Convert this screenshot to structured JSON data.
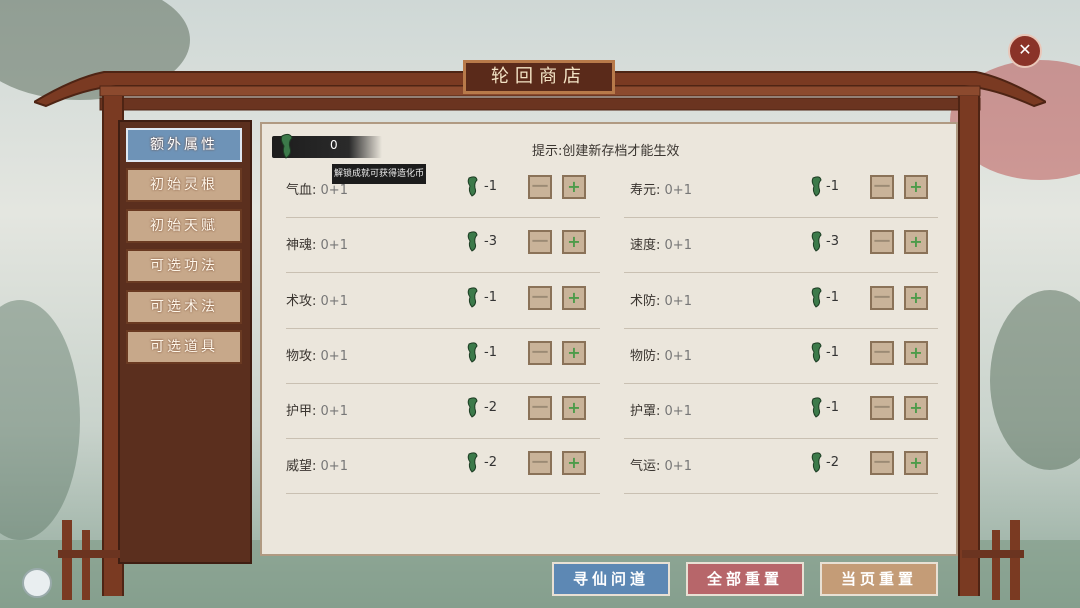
{
  "window": {
    "title": "轮回商店",
    "close_icon": "close-icon"
  },
  "sidebar": {
    "items": [
      {
        "label": "额外属性",
        "active": true
      },
      {
        "label": "初始灵根",
        "active": false
      },
      {
        "label": "初始天赋",
        "active": false
      },
      {
        "label": "可选功法",
        "active": false
      },
      {
        "label": "可选术法",
        "active": false
      },
      {
        "label": "可选道具",
        "active": false
      }
    ]
  },
  "currency": {
    "value": "0",
    "icon": "scroll-coin-icon",
    "tooltip": "解锁成就可获得造化币"
  },
  "hint": "提示:创建新存档才能生效",
  "stats": [
    {
      "name": "气血:",
      "value": "0+1",
      "cost": "-1"
    },
    {
      "name": "寿元:",
      "value": "0+1",
      "cost": "-1"
    },
    {
      "name": "神魂:",
      "value": "0+1",
      "cost": "-3"
    },
    {
      "name": "速度:",
      "value": "0+1",
      "cost": "-3"
    },
    {
      "name": "术攻:",
      "value": "0+1",
      "cost": "-1"
    },
    {
      "name": "术防:",
      "value": "0+1",
      "cost": "-1"
    },
    {
      "name": "物攻:",
      "value": "0+1",
      "cost": "-1"
    },
    {
      "name": "物防:",
      "value": "0+1",
      "cost": "-1"
    },
    {
      "name": "护甲:",
      "value": "0+1",
      "cost": "-2"
    },
    {
      "name": "护罩:",
      "value": "0+1",
      "cost": "-1"
    },
    {
      "name": "威望:",
      "value": "0+1",
      "cost": "-2"
    },
    {
      "name": "气运:",
      "value": "0+1",
      "cost": "-2"
    }
  ],
  "controls": {
    "minus": "一",
    "plus": "+"
  },
  "bottom": {
    "seek": "寻仙问道",
    "reset_all": "全部重置",
    "reset_page": "当页重置"
  },
  "colors": {
    "active_tab": "#6e93b7",
    "seek_button": "#5d88b4",
    "reset_all_button": "#b7666a",
    "reset_page_button": "#c49c77",
    "wood": "#7a3a22"
  }
}
